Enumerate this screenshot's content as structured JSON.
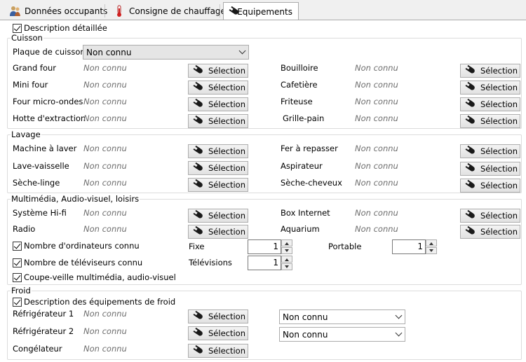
{
  "tabs": [
    {
      "label": "Données occupants",
      "icon": "occupants-icon"
    },
    {
      "label": "Consigne de chauffage",
      "icon": "thermometer-icon"
    },
    {
      "label": "Equipements",
      "icon": "plug-icon"
    }
  ],
  "detail_checkbox": {
    "label": "Description détaillée",
    "checked": true
  },
  "not_known": "Non connu",
  "select_label": "Sélection",
  "cuisson": {
    "title": "Cuisson",
    "plaque": {
      "label": "Plaque de cuisson",
      "value": "Non connu"
    },
    "left": [
      {
        "label": "Grand four",
        "value": "Non connu",
        "button": "Sélection"
      },
      {
        "label": "Mini four",
        "value": "Non connu",
        "button": "Sélection"
      },
      {
        "label": "Four micro-ondes",
        "value": "Non connu",
        "button": "Sélection"
      },
      {
        "label": "Hotte d'extraction",
        "value": "Non connu",
        "button": "Sélection"
      }
    ],
    "right": [
      {
        "label": "Bouilloire",
        "value": "Non connu",
        "button": "Sélection"
      },
      {
        "label": "Cafetière",
        "value": "Non connu",
        "button": "Sélection"
      },
      {
        "label": "Friteuse",
        "value": "Non connu",
        "button": "Sélection"
      },
      {
        "label": "Grille-pain",
        "value": "Non connu",
        "button": "Sélection"
      }
    ]
  },
  "lavage": {
    "title": "Lavage",
    "left": [
      {
        "label": "Machine à laver",
        "value": "Non connu",
        "button": "Sélection"
      },
      {
        "label": "Lave-vaisselle",
        "value": "Non connu",
        "button": "Sélection"
      },
      {
        "label": "Sèche-linge",
        "value": "Non connu",
        "button": "Sélection"
      }
    ],
    "right": [
      {
        "label": "Fer à repasser",
        "value": "Non connu",
        "button": "Sélection"
      },
      {
        "label": "Aspirateur",
        "value": "Non connu",
        "button": "Sélection"
      },
      {
        "label": "Sèche-cheveux",
        "value": "Non connu",
        "button": "Sélection"
      }
    ]
  },
  "multimedia": {
    "title": "Multimédia, Audio-visuel, loisirs",
    "left": [
      {
        "label": "Système Hi-fi",
        "value": "Non connu",
        "button": "Sélection"
      },
      {
        "label": "Radio",
        "value": "Non connu",
        "button": "Sélection"
      }
    ],
    "right": [
      {
        "label": "Box Internet",
        "value": "Non connu",
        "button": "Sélection"
      },
      {
        "label": "Aquarium",
        "value": "Non connu",
        "button": "Sélection"
      }
    ],
    "computers": {
      "label": "Nombre d'ordinateurs connu",
      "checked": true,
      "fixe_label": "Fixe",
      "fixe_value": "1",
      "portable_label": "Portable",
      "portable_value": "1"
    },
    "tvs": {
      "label": "Nombre de téléviseurs connu",
      "checked": true,
      "tv_label": "Télévisions",
      "tv_value": "1"
    },
    "standby": {
      "label": "Coupe-veille multimédia, audio-visuel",
      "checked": true
    }
  },
  "froid": {
    "title": "Froid",
    "desc": {
      "label": "Description des équipements de froid",
      "checked": true
    },
    "items": [
      {
        "label": "Réfrigérateur 1",
        "value": "Non connu",
        "button": "Sélection",
        "select": "Non connu"
      },
      {
        "label": "Réfrigérateur 2",
        "value": "Non connu",
        "button": "Sélection",
        "select": "Non connu"
      },
      {
        "label": "Congélateur",
        "value": "Non connu",
        "button": "Sélection"
      }
    ]
  }
}
